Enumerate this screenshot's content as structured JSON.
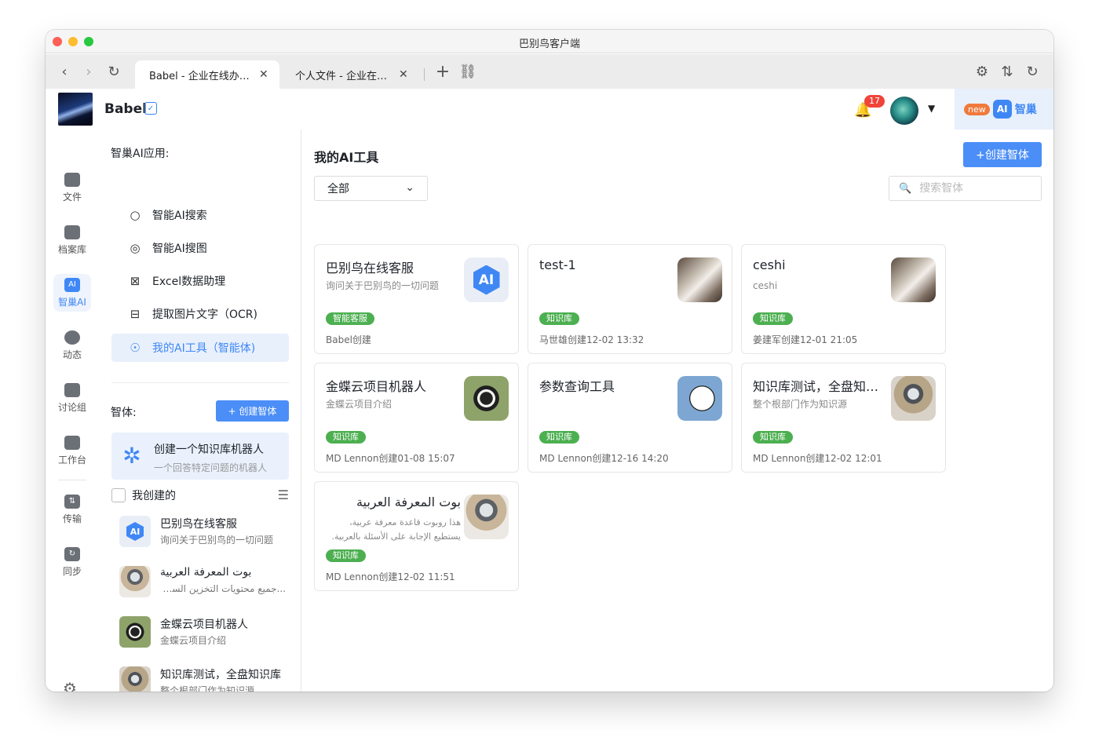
{
  "window": {
    "title": "巴别鸟客户端"
  },
  "browser": {
    "tabs": [
      {
        "label": "Babel - 企业在线办公网盘",
        "active": true
      },
      {
        "label": "个人文件 - 企业在线办公网盘",
        "active": false
      }
    ]
  },
  "header": {
    "brand": "Babel",
    "notifications": "17",
    "new_badge": "new",
    "ai_logo": "AI",
    "ai_brand": "智巢"
  },
  "rail": {
    "items": [
      {
        "label": "文件",
        "icon": "folder-icon"
      },
      {
        "label": "档案库",
        "icon": "archive-icon"
      },
      {
        "label": "智巢AI",
        "icon": "ai-icon"
      },
      {
        "label": "动态",
        "icon": "activity-icon"
      },
      {
        "label": "讨论组",
        "icon": "chat-icon"
      },
      {
        "label": "工作台",
        "icon": "workbench-icon"
      },
      {
        "label": "传输",
        "icon": "transfer-icon"
      },
      {
        "label": "同步",
        "icon": "sync-icon"
      }
    ]
  },
  "sidebar": {
    "apps_title": "智巢AI应用:",
    "apps": [
      {
        "label": "智能AI搜索",
        "icon": "search-icon"
      },
      {
        "label": "智能AI搜图",
        "icon": "image-search-icon"
      },
      {
        "label": "Excel数据助理",
        "icon": "excel-icon"
      },
      {
        "label": "提取图片文字（OCR)",
        "icon": "ocr-icon"
      },
      {
        "label": "我的AI工具（智能体)",
        "icon": "ai-tool-icon"
      }
    ],
    "agents_title": "智体:",
    "create_small": "+ 创建智体",
    "create_card": {
      "title": "创建一个知识库机器人",
      "subtitle": "一个回答特定问题的机器人"
    },
    "mine_label": "我创建的",
    "agents": [
      {
        "name": "巴别鸟在线客服",
        "desc": "询问关于巴别鸟的一切问题"
      },
      {
        "name": "بوت المعرفة العربية",
        "desc": "...جميع محتويات التخزين السحابي"
      },
      {
        "name": "金蝶云项目机器人",
        "desc": "金蝶云项目介绍"
      },
      {
        "name": "知识库测试，全盘知识库",
        "desc": "整个根部门作为知识源"
      }
    ]
  },
  "main": {
    "title": "我的AI工具",
    "create_button": "+创建智体",
    "filter_value": "全部",
    "search_placeholder": "搜索智体",
    "cards": [
      {
        "name": "巴别鸟在线客服",
        "desc": "询问关于巴别鸟的一切问题",
        "tag": "智能客服",
        "meta": "Babel创建",
        "avatar": "AI"
      },
      {
        "name": "test-1",
        "desc": "",
        "tag": "知识库",
        "meta": "马世雄创建12-02 13:32"
      },
      {
        "name": "ceshi",
        "desc": "ceshi",
        "tag": "知识库",
        "meta": "姜建军创建12-01 21:05"
      },
      {
        "name": "金蝶云项目机器人",
        "desc": "金蝶云项目介绍",
        "tag": "知识库",
        "meta": "MD Lennon创建01-08 15:07"
      },
      {
        "name": "参数查询工具",
        "desc": "",
        "tag": "知识库",
        "meta": "MD Lennon创建12-16 14:20"
      },
      {
        "name": "知识库测试，全盘知识库",
        "desc": "整个根部门作为知识源",
        "tag": "知识库",
        "meta": "MD Lennon创建12-02 12:01"
      },
      {
        "name": "بوت المعرفة العربية",
        "desc": "هذا روبوت قاعدة معرفة عربية، يستطيع الإجابة على الأسئلة بالعربية. نطاق قاعدة",
        "tag": "知识库",
        "meta": "MD Lennon创建12-02 11:51"
      }
    ]
  }
}
